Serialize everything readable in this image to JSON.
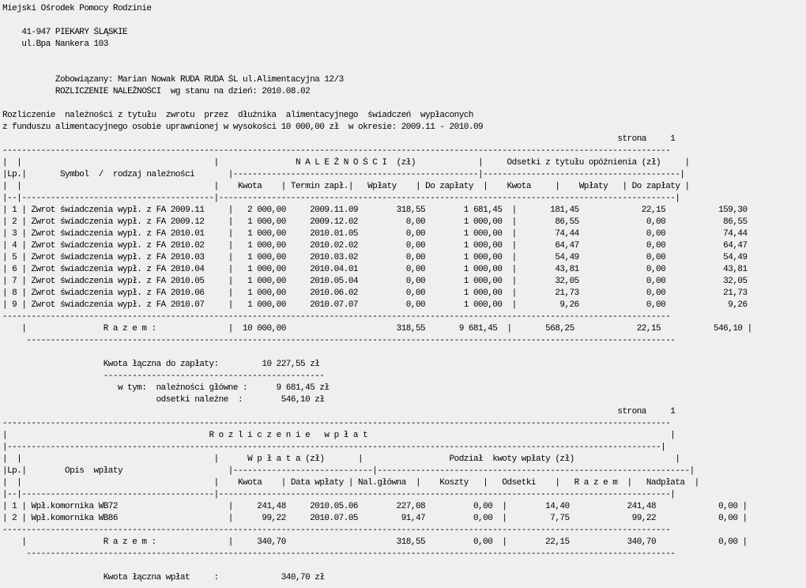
{
  "header": {
    "organization": "Miejski Ośrodek Pomocy Rodzinie",
    "address_city": "    41-947 PIEKARY ŚLĄSKIE",
    "address_street": "    ul.Bpa Nankera 103",
    "obligated": "           Zobowiązany: Marian Nowak RUDA RUDA ŚL ul.Alimentacyjna 12/3",
    "report_title": "           ROZLICZENIE NALEŻNOŚCI  wg stanu na dzień: 2010.08.02",
    "description_line1": "Rozliczenie  należności z tytułu  zwrotu  przez  dłużnika  alimentacyjnego  świadczeń  wypłaconych",
    "description_line2": "z funduszu alimentacyjnego osobie uprawnionej w wysokości 10 000,00 zł  w okresie: 2009.11 - 2010.09",
    "page_label_1": "                                                                                                                                strona     1"
  },
  "receivables": {
    "rule_top": "-------------------------------------------------------------------------------------------------------------------------------------------",
    "header_line1": "|  |                                        |                N A L E Ż N O Ś C I  (zł)             |     Odsetki z tytułu opóźnienia (zł)     |",
    "header_line2": "|Lp.|       Symbol  /  rodzaj należności       |---------------------------------------------------|-----------------------------------------|",
    "header_line3": "|  |                                        |    Kwota    | Termin zapł.|   Wpłaty    | Do zapłaty  |    Kwota     |    Wpłaty   | Do zapłaty |",
    "rule_header": "|--|----------------------------------------|-----------------------------------------------------------------------------------------------|",
    "rows": [
      "| 1 | Zwrot świadczenia wypł. z FA 2009.11     |   2 000,00     2009.11.09        318,55        1 681,45  |       181,45             22,15           159,30",
      "| 2 | Zwrot świadczenia wypł. z FA 2009.12     |   1 000,00     2009.12.02          0,00        1 000,00  |        86,55              0,00            86,55",
      "| 3 | Zwrot świadczenia wypł. z FA 2010.01     |   1 000,00     2010.01.05          0,00        1 000,00  |        74,44              0,00            74,44",
      "| 4 | Zwrot świadczenia wypł. z FA 2010.02     |   1 000,00     2010.02.02          0,00        1 000,00  |        64,47              0,00            64,47",
      "| 5 | Zwrot świadczenia wypł. z FA 2010.03     |   1 000,00     2010.03.02          0,00        1 000,00  |        54,49              0,00            54,49",
      "| 6 | Zwrot świadczenia wypł. z FA 2010.04     |   1 000,00     2010.04.01          0,00        1 000,00  |        43,81              0,00            43,81",
      "| 7 | Zwrot świadczenia wypł. z FA 2010.05     |   1 000,00     2010.05.04          0,00        1 000,00  |        32,05              0,00            32,05",
      "| 8 | Zwrot świadczenia wypł. z FA 2010.06     |   1 000,00     2010.06.02          0,00        1 000,00  |        21,73              0,00            21,73",
      "| 9 | Zwrot świadczenia wypł. z FA 2010.07     |   1 000,00     2010.07.07          0,00        1 000,00  |         9,26              0,00             9,26"
    ],
    "rule_bottom": "-------------------------------------------------------------------------------------------------------------------------------------------",
    "total_row": "    |                R a z e m :               |  10 000,00                       318,55       9 681,45  |       568,25             22,15           546,10 |",
    "rule_total": "     ---------------------------------------------------------------------------------------------------------------------------------------",
    "summary_total": "                     Kwota łączna do zapłaty:         10 227,55 zł",
    "summary_rule": "                     ----------------------------------------------",
    "summary_main": "                        w tym:  należności główne :      9 681,45 zł",
    "summary_interest": "                                odsetki należne  :        546,10 zł",
    "page_label_2": "                                                                                                                                strona     1"
  },
  "payments": {
    "rule_top": "-------------------------------------------------------------------------------------------------------------------------------------------",
    "title_line": "|                                          R o z l i c z e n i e   w p ł a t                                                               |",
    "rule_title": "|----------------------------------------------------------------------------------------------------------------------------------------|",
    "header_line1": "|  |                                        |      W p ł a t a (zł)       |                  Podział  kwoty wpłaty (zł)                     |",
    "header_line2": "|Lp.|        Opis  wpłaty                      |-----------------------------|-----------------------------------------------------------------|",
    "header_line3": "|  |                                        |    Kwota    | Data wpłaty | Nal.główna  |    Koszty   |   Odsetki    |   R a z e m  |   Nadpłata  |",
    "rule_header": "|--|----------------------------------------|----------------------------------------------------------------------------------------------|",
    "rows": [
      "| 1 | Wpł.komornika WB72                       |     241,48     2010.05.06        227,08          0,00  |        14,40            241,48             0,00 |",
      "| 2 | Wpł.komornika WB86                       |      99,22     2010.07.05         91,47          0,00  |         7,75             99,22             0,00 |"
    ],
    "rule_bottom": "-------------------------------------------------------------------------------------------------------------------------------------------",
    "total_row": "    |                R a z e m :               |     340,70                       318,55          0,00  |        22,15            340,70             0,00 |",
    "rule_total": "     ---------------------------------------------------------------------------------------------------------------------------------------",
    "summary_total": "                     Kwota łączna wpłat     :             340,70 zł"
  }
}
